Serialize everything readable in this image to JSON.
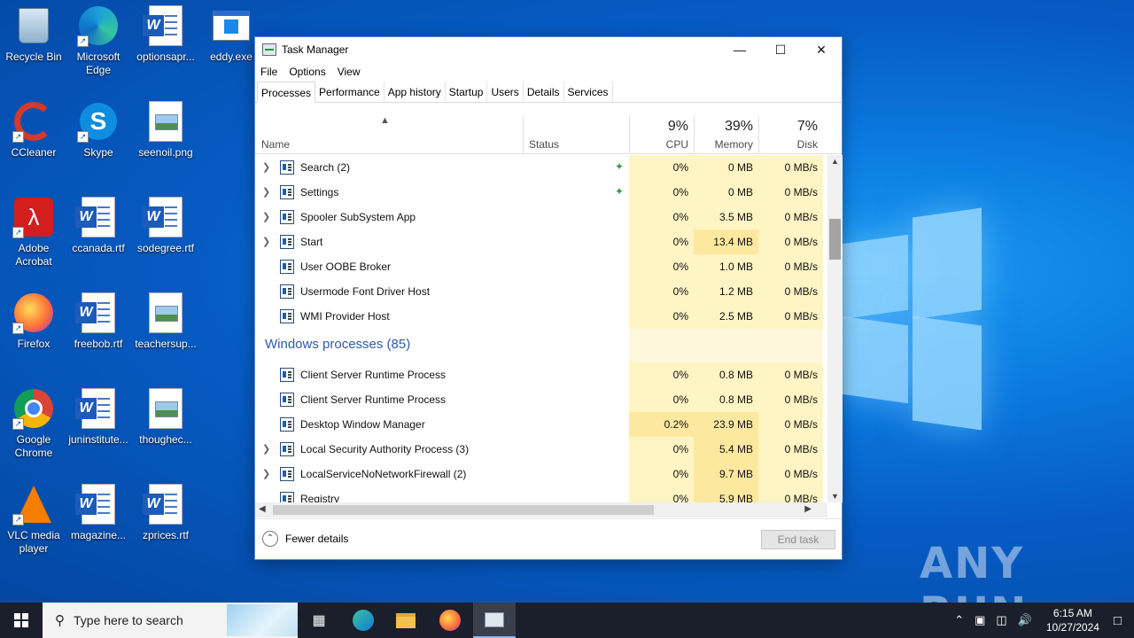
{
  "desktop": {
    "icons": [
      {
        "label": "Recycle Bin",
        "icon": "recycle-bin-icon"
      },
      {
        "label": "Microsoft Edge",
        "icon": "edge-icon"
      },
      {
        "label": "optionsapr...",
        "icon": "word-doc-icon"
      },
      {
        "label": "eddy.exe",
        "icon": "exe-icon"
      },
      {
        "label": "CCleaner",
        "icon": "ccleaner-icon"
      },
      {
        "label": "Skype",
        "icon": "skype-icon"
      },
      {
        "label": "seenoil.png",
        "icon": "png-file-icon"
      },
      {
        "label": "Adobe Acrobat",
        "icon": "acrobat-icon"
      },
      {
        "label": "ccanada.rtf",
        "icon": "word-doc-icon"
      },
      {
        "label": "sodegree.rtf",
        "icon": "word-doc-icon"
      },
      {
        "label": "Firefox",
        "icon": "firefox-icon"
      },
      {
        "label": "freebob.rtf",
        "icon": "word-doc-icon"
      },
      {
        "label": "teachersup...",
        "icon": "png-file-icon"
      },
      {
        "label": "Google Chrome",
        "icon": "chrome-icon"
      },
      {
        "label": "juninstitute...",
        "icon": "word-doc-icon"
      },
      {
        "label": "thoughec...",
        "icon": "png-file-icon"
      },
      {
        "label": "VLC media player",
        "icon": "vlc-icon"
      },
      {
        "label": "magazine...",
        "icon": "word-doc-icon"
      },
      {
        "label": "zprices.rtf",
        "icon": "word-doc-icon"
      }
    ],
    "watermark": "ANY RUN"
  },
  "taskmanager": {
    "title": "Task Manager",
    "menu": [
      "File",
      "Options",
      "View"
    ],
    "tabs": [
      "Processes",
      "Performance",
      "App history",
      "Startup",
      "Users",
      "Details",
      "Services"
    ],
    "active_tab": "Processes",
    "columns": {
      "name": "Name",
      "status": "Status",
      "cpu": {
        "pct": "9%",
        "label": "CPU"
      },
      "memory": {
        "pct": "39%",
        "label": "Memory"
      },
      "disk": {
        "pct": "7%",
        "label": "Disk"
      }
    },
    "rows": [
      {
        "name": "Search (2)",
        "expand": true,
        "leaf": true,
        "cpu": "0%",
        "mem": "0 MB",
        "disk": "0 MB/s",
        "icon": "search-app-icon"
      },
      {
        "name": "Settings",
        "expand": true,
        "leaf": true,
        "cpu": "0%",
        "mem": "0 MB",
        "disk": "0 MB/s",
        "icon": "settings-gear-icon"
      },
      {
        "name": "Spooler SubSystem App",
        "expand": true,
        "leaf": false,
        "cpu": "0%",
        "mem": "3.5 MB",
        "disk": "0 MB/s",
        "icon": "printer-icon"
      },
      {
        "name": "Start",
        "expand": true,
        "leaf": false,
        "cpu": "0%",
        "mem": "13.4 MB",
        "disk": "0 MB/s",
        "icon": "start-app-icon"
      },
      {
        "name": "User OOBE Broker",
        "expand": false,
        "leaf": false,
        "cpu": "0%",
        "mem": "1.0 MB",
        "disk": "0 MB/s",
        "icon": "process-window-icon"
      },
      {
        "name": "Usermode Font Driver Host",
        "expand": false,
        "leaf": false,
        "cpu": "0%",
        "mem": "1.2 MB",
        "disk": "0 MB/s",
        "icon": "process-window-icon"
      },
      {
        "name": "WMI Provider Host",
        "expand": false,
        "leaf": false,
        "cpu": "0%",
        "mem": "2.5 MB",
        "disk": "0 MB/s",
        "icon": "wmi-icon"
      }
    ],
    "group_label": "Windows processes (85)",
    "rows2": [
      {
        "name": "Client Server Runtime Process",
        "expand": false,
        "cpu": "0%",
        "mem": "0.8 MB",
        "disk": "0 MB/s",
        "icon": "process-window-icon"
      },
      {
        "name": "Client Server Runtime Process",
        "expand": false,
        "cpu": "0%",
        "mem": "0.8 MB",
        "disk": "0 MB/s",
        "icon": "process-window-icon"
      },
      {
        "name": "Desktop Window Manager",
        "expand": false,
        "cpu": "0.2%",
        "mem": "23.9 MB",
        "disk": "0 MB/s",
        "icon": "process-window-icon"
      },
      {
        "name": "Local Security Authority Process (3)",
        "expand": true,
        "cpu": "0%",
        "mem": "5.4 MB",
        "disk": "0 MB/s",
        "icon": "process-window-icon"
      },
      {
        "name": "LocalServiceNoNetworkFirewall (2)",
        "expand": true,
        "cpu": "0%",
        "mem": "9.7 MB",
        "disk": "0 MB/s",
        "icon": "settings-gear-icon"
      },
      {
        "name": "Registry",
        "expand": false,
        "cpu": "0%",
        "mem": "5.9 MB",
        "disk": "0 MB/s",
        "icon": "process-window-icon"
      }
    ],
    "fewer_details": "Fewer details",
    "end_task": "End task"
  },
  "taskbar": {
    "search_placeholder": "Type here to search",
    "time": "6:15 AM",
    "date": "10/27/2024"
  },
  "colors": {
    "accent": "#0a79e0",
    "heat_light": "#fff4c4",
    "heat_medium": "#fde8a0",
    "group_text": "#2d5ca8"
  }
}
